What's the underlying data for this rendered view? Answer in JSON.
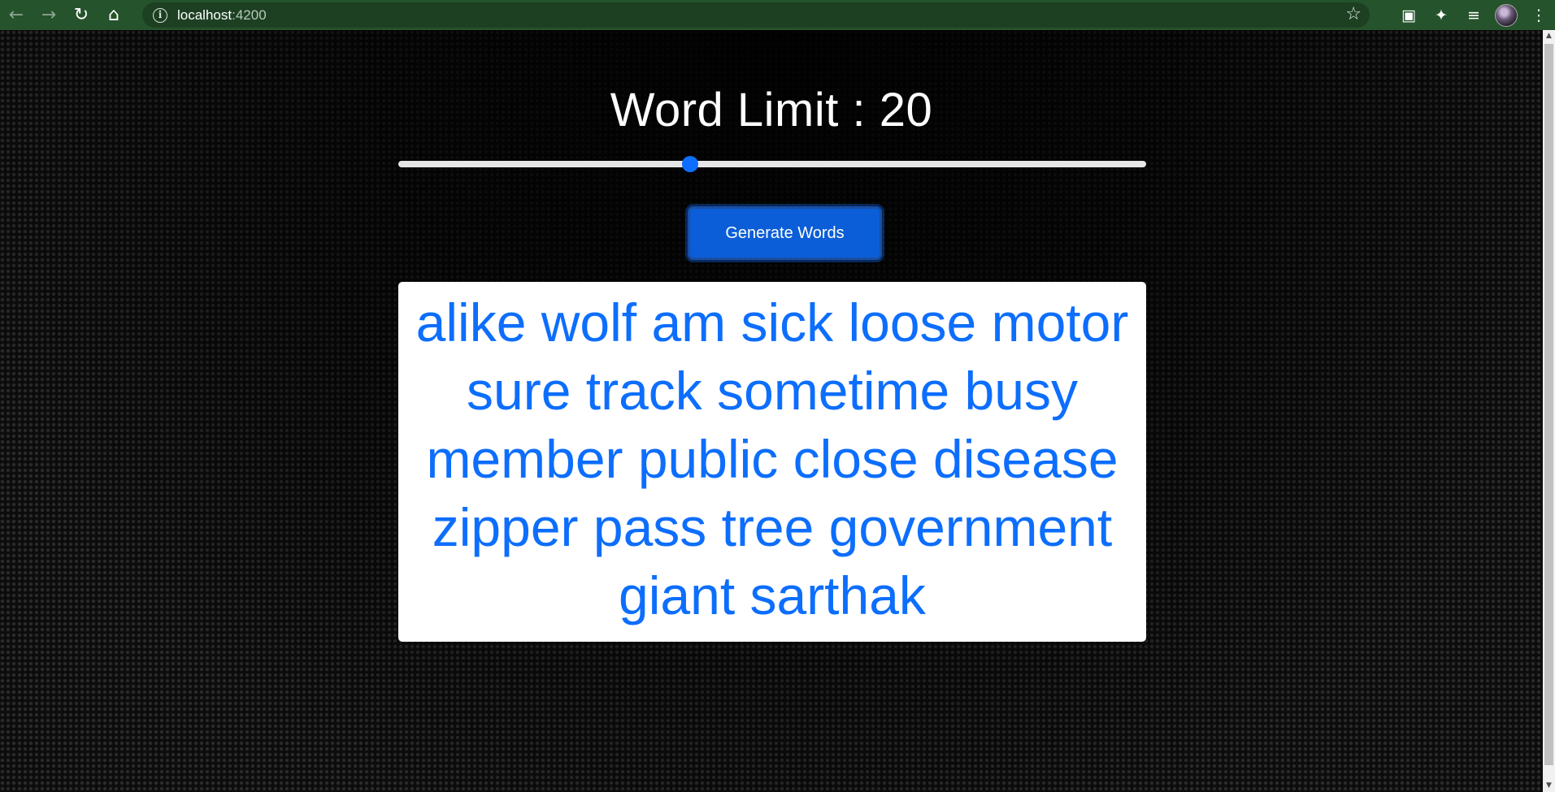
{
  "browser": {
    "url_host": "localhost",
    "url_port": ":4200",
    "icons": [
      "back-arrow-icon",
      "forward-arrow-icon",
      "reload-icon",
      "home-icon",
      "info-icon",
      "star-icon",
      "media-icon",
      "extensions-icon",
      "reading-list-icon",
      "profile-avatar",
      "menu-icon"
    ]
  },
  "page": {
    "title": "Word Limit : 20",
    "slider": {
      "value": 20,
      "level": 0.39
    },
    "generate_label": "Generate Words",
    "words": "alike wolf am sick loose motor sure track sometime busy member public close disease zipper pass tree government giant sarthak"
  },
  "colors": {
    "toolbar": "#25532b",
    "accent": "#0d6efd",
    "button": "#0b5ed7"
  }
}
